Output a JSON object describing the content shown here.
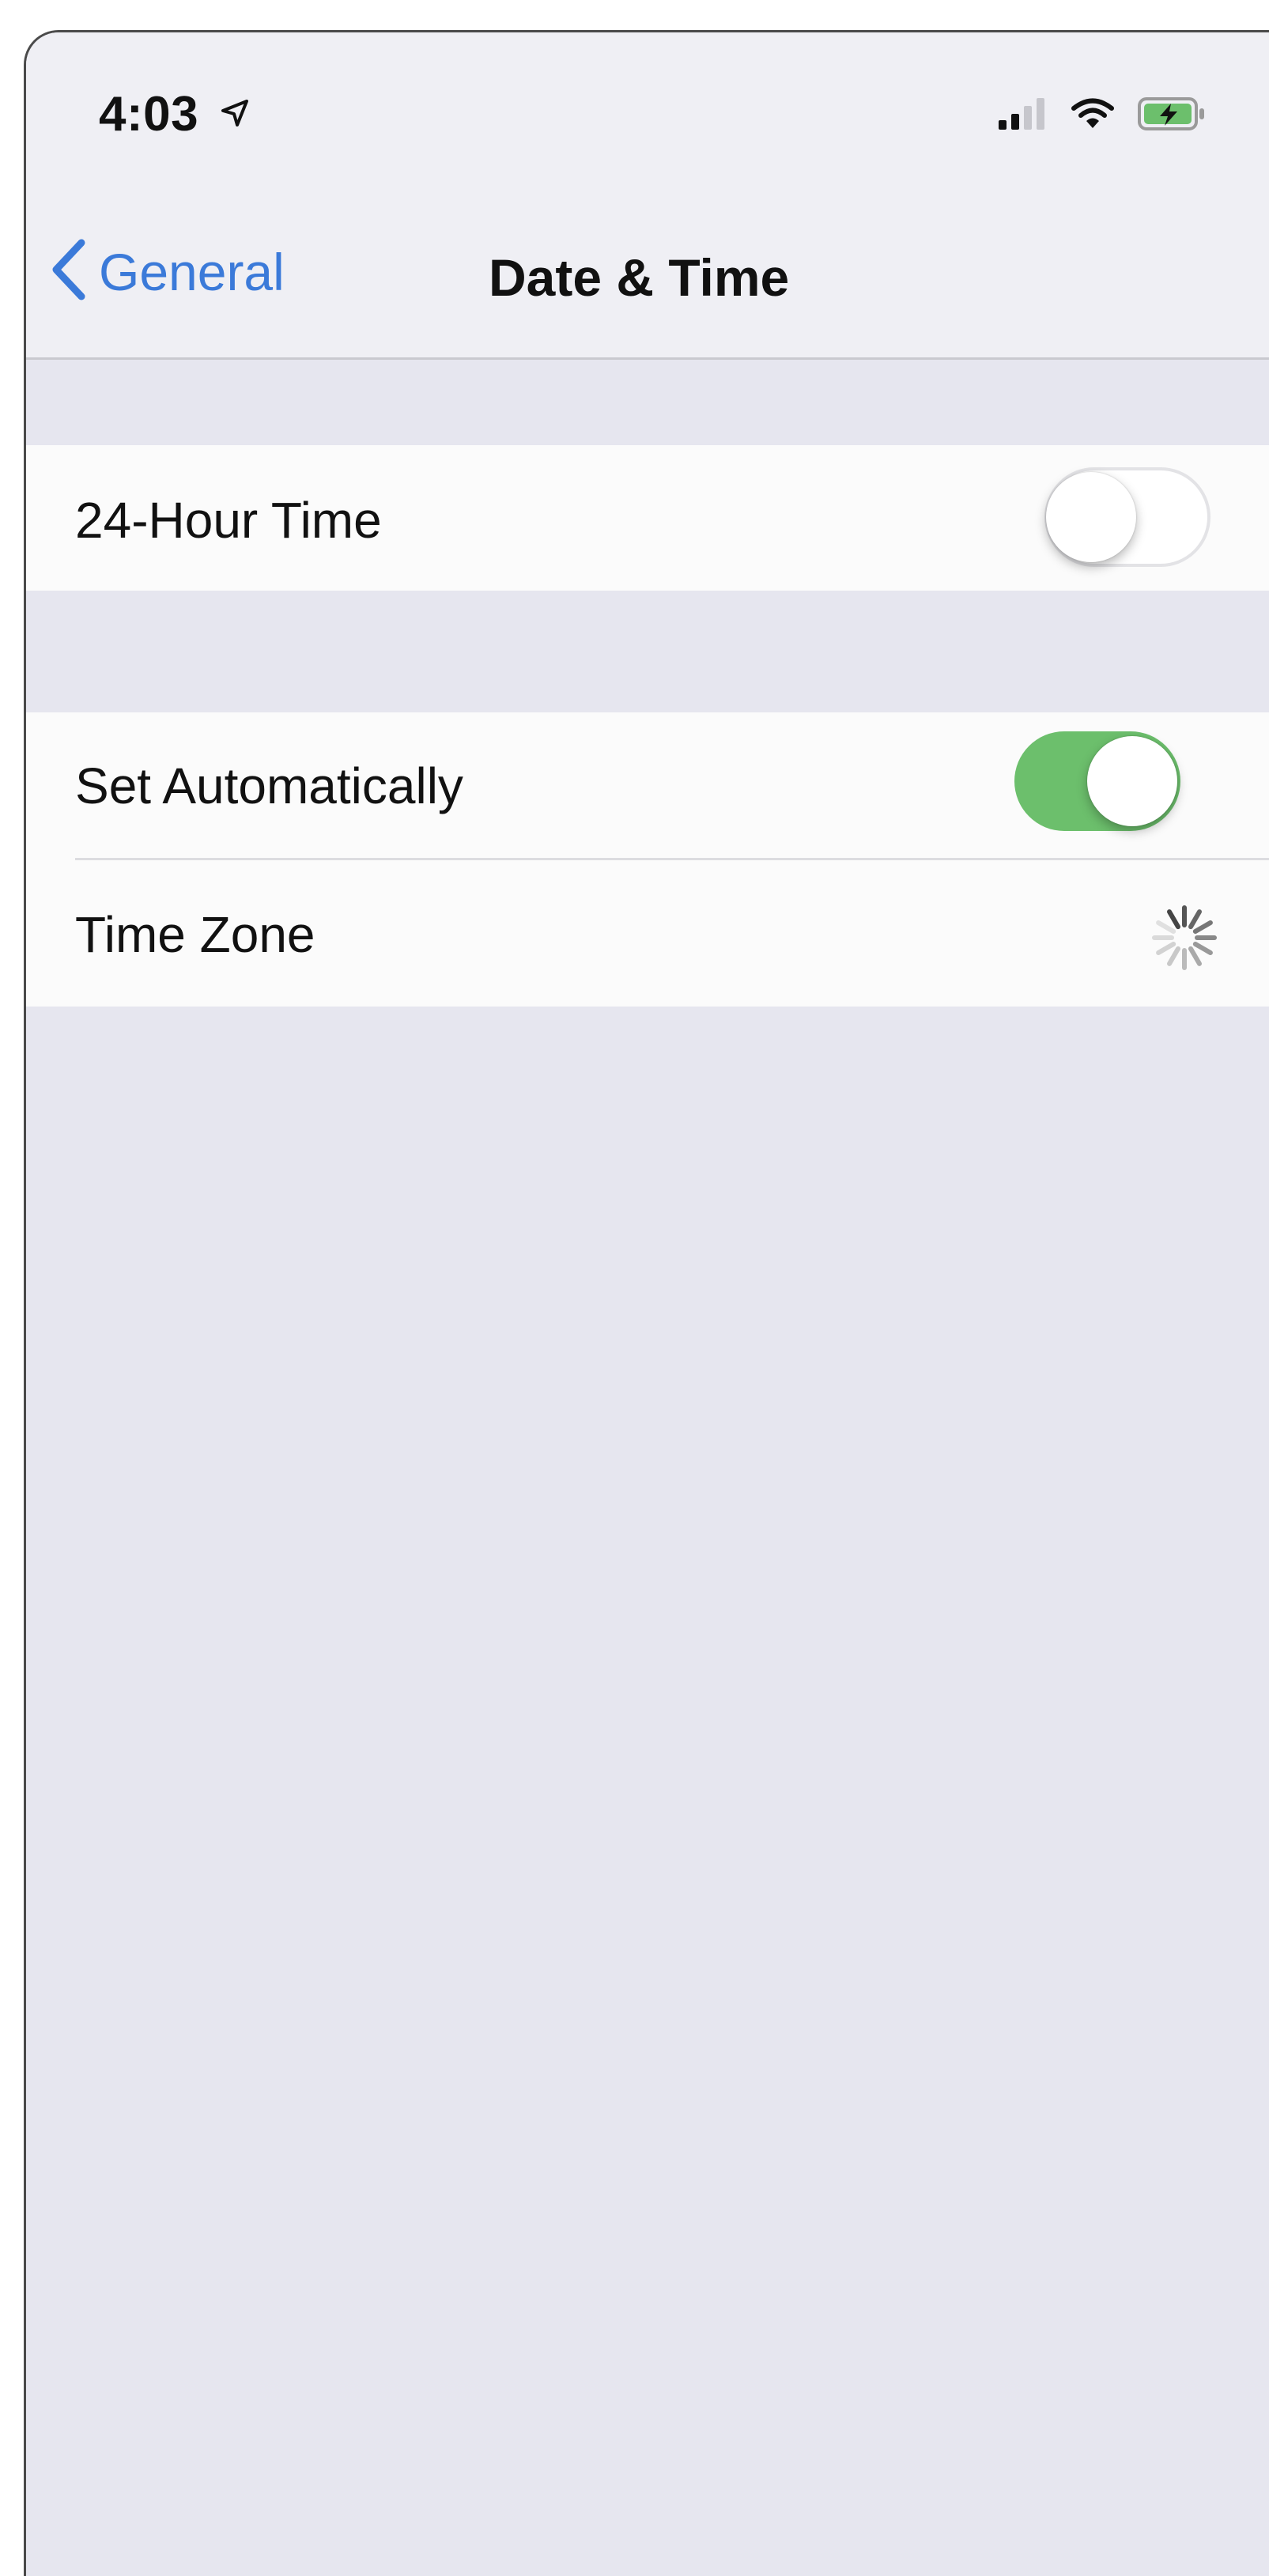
{
  "status_bar": {
    "time": "4:03",
    "icons": [
      "location-arrow-icon",
      "signal-icon",
      "wifi-icon",
      "battery-charging-icon"
    ]
  },
  "nav": {
    "back_label": "General",
    "title": "Date & Time"
  },
  "settings": {
    "twenty_four_hour": {
      "label": "24-Hour Time",
      "enabled": false
    },
    "set_automatically": {
      "label": "Set Automatically",
      "enabled": true
    },
    "time_zone": {
      "label": "Time Zone",
      "status": "loading"
    }
  },
  "colors": {
    "accent_blue": "#3b7ad9",
    "toggle_on_green": "#6cbf6c",
    "background": "#e6e6ef",
    "cell_background": "#fbfbfb"
  }
}
